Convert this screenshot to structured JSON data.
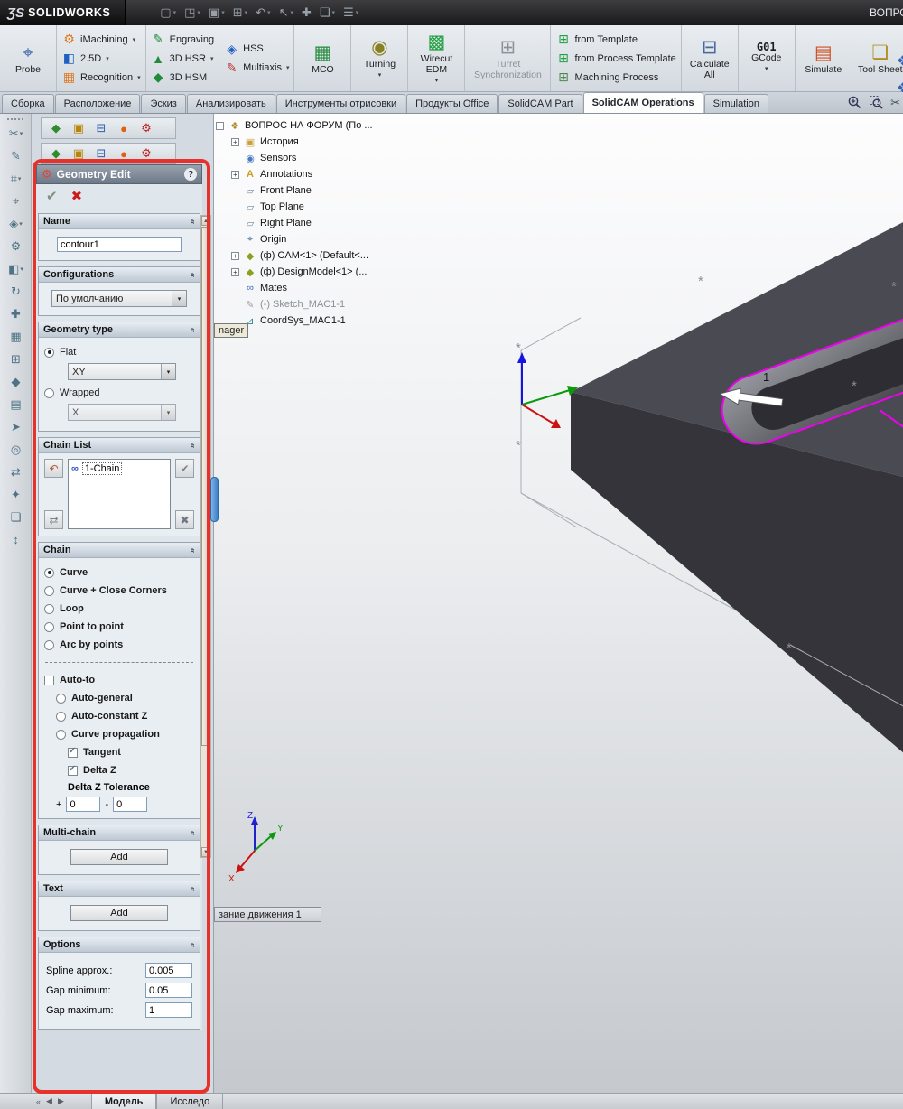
{
  "colors": {
    "highlight": "#e6322a",
    "contour": "#ee00ee",
    "part_top": "#4a4a52",
    "part_front": "#34343a"
  },
  "icons": {
    "dropdown": "▾",
    "plus": "+",
    "minus": "−",
    "chevron_up": "«",
    "ok": "✔",
    "cancel": "✖",
    "undo": "↶",
    "swap": "⇄",
    "check": "✔",
    "delete": "✖",
    "asterisk": "*",
    "probe": "⌖",
    "imachining": "⚙",
    "two_five_d": "◧",
    "recognition": "▦",
    "engraving": "✎",
    "hsr": "▲",
    "hsm": "◆",
    "hss": "◈",
    "multiaxis": "✎",
    "mco": "▦",
    "turning": "◉",
    "wirecut": "▩",
    "turret": "⊞",
    "template": "⊞",
    "process_template": "⊞",
    "machining_process": "⊞",
    "calculate": "⊟",
    "simulate": "▤",
    "toolsheet": "❏",
    "panel_header": "⚙",
    "chain_link": "∞",
    "scissors": "✂",
    "nav_first": "«",
    "nav_prev": "◀",
    "nav_next": "▶"
  },
  "titlebar": {
    "logo_ds": "ƷS",
    "logo_text": "SOLIDWORKS",
    "right_text": "ВОПРОС",
    "icons": [
      "▢",
      "◳",
      "▣",
      "⊞",
      "↶",
      "↖",
      "✚",
      "❏",
      "☰"
    ]
  },
  "ribbon": {
    "probe": {
      "label": "Probe"
    },
    "group1": [
      {
        "label": "iMachining"
      },
      {
        "label": "2.5D"
      },
      {
        "label": "Recognition"
      }
    ],
    "group2": [
      {
        "label": "Engraving"
      },
      {
        "label": "3D HSR"
      },
      {
        "label": "3D HSM"
      }
    ],
    "group3": [
      {
        "label": "HSS"
      },
      {
        "label": "Multiaxis"
      }
    ],
    "mco": {
      "label": "MCO"
    },
    "turning": {
      "label": "Turning"
    },
    "wirecut": {
      "label": "Wirecut EDM"
    },
    "turret": {
      "label": "Turret Synchronization"
    },
    "group4": [
      {
        "label": "from Template"
      },
      {
        "label": "from Process Template"
      },
      {
        "label": "Machining Process"
      }
    ],
    "calculate": {
      "label": "Calculate All"
    },
    "gcode": {
      "top": "G01",
      "label": "GCode"
    },
    "simulate": {
      "label": "Simulate"
    },
    "toolsheet": {
      "label": "Tool Sheet"
    }
  },
  "tabs": {
    "items": [
      "Сборка",
      "Расположение",
      "Эскиз",
      "Анализировать",
      "Инструменты отрисовки",
      "Продукты Office",
      "SolidCAM Part",
      "SolidCAM Operations",
      "Simulation"
    ],
    "active": "SolidCAM Operations"
  },
  "manager_tabs": {
    "glyphs": [
      "◆",
      "▣",
      "⊟",
      "●",
      "⚙"
    ]
  },
  "left_toolbar": {
    "glyphs": [
      "✂",
      "✎",
      "⌗",
      "⌖",
      "◈",
      "⚙",
      "◧",
      "↻",
      "✚",
      "▦",
      "⊞",
      "◆",
      "▤",
      "➤",
      "◎",
      "⇄",
      "✦",
      "❏",
      "↕"
    ]
  },
  "panel": {
    "title": "Geometry Edit",
    "help": "?",
    "sections": {
      "name": {
        "header": "Name",
        "value": "contour1"
      },
      "configurations": {
        "header": "Configurations",
        "value": "По умолчанию"
      },
      "geometry_type": {
        "header": "Geometry type",
        "flat": "Flat",
        "flat_plane": "XY",
        "wrapped": "Wrapped",
        "wrapped_axis": "X"
      },
      "chain_list": {
        "header": "Chain List",
        "item": "1-Chain"
      },
      "chain": {
        "header": "Chain",
        "options": [
          "Curve",
          "Curve + Close Corners",
          "Loop",
          "Point to point",
          "Arc by points"
        ],
        "selected": "Curve",
        "auto_to": "Auto-to",
        "auto_options": [
          "Auto-general",
          "Auto-constant Z",
          "Curve propagation"
        ],
        "tangent": "Tangent",
        "delta_z": "Delta Z",
        "tolerance_label": "Delta Z Tolerance",
        "plus": "+",
        "minus": "-",
        "plus_value": "0",
        "minus_value": "0"
      },
      "multi_chain": {
        "header": "Multi-chain",
        "add": "Add"
      },
      "text": {
        "header": "Text",
        "add": "Add"
      },
      "options": {
        "header": "Options",
        "spline_label": "Spline approx.:",
        "spline_value": "0.005",
        "gap_min_label": "Gap minimum:",
        "gap_min_value": "0.05",
        "gap_max_label": "Gap maximum:",
        "gap_max_value": "1"
      }
    }
  },
  "tree": {
    "items": [
      {
        "label": "ВОПРОС НА ФОРУМ  (По ..."
      },
      {
        "label": "История"
      },
      {
        "label": "Sensors"
      },
      {
        "label": "Annotations"
      },
      {
        "label": "Front Plane"
      },
      {
        "label": "Top Plane"
      },
      {
        "label": "Right Plane"
      },
      {
        "label": "Origin"
      },
      {
        "label": "(ф) CAM<1> (Default<..."
      },
      {
        "label": "(ф) DesignModel<1> (..."
      },
      {
        "label": "Mates"
      },
      {
        "label": "(-) Sketch_MAC1-1"
      },
      {
        "label": "CoordSys_MAC1-1"
      }
    ],
    "tooltip": "nager"
  },
  "viewport": {
    "arrow_label": "1",
    "triad": {
      "z": "Z",
      "y": "Y",
      "x": "X"
    },
    "motion_tab": "зание движения 1"
  },
  "bottom": {
    "tabs": [
      "Модель",
      "Исследо"
    ],
    "active": "Модель"
  }
}
